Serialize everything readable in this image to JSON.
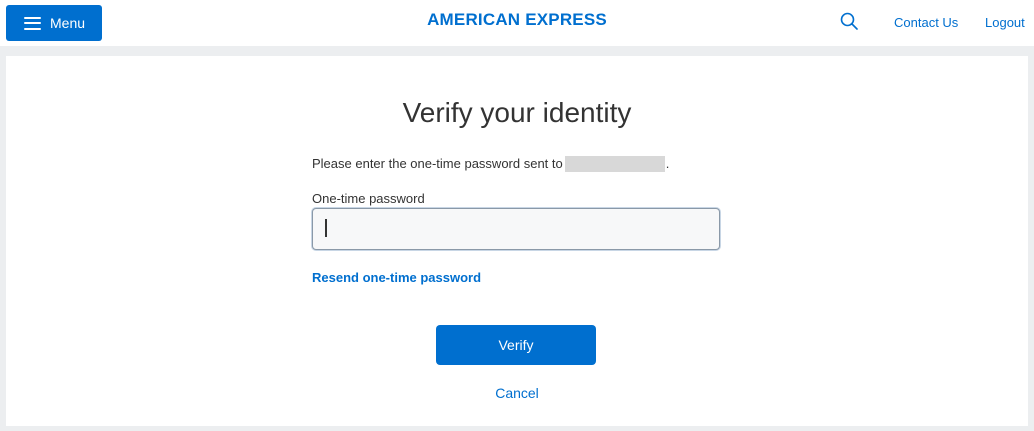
{
  "header": {
    "menu_label": "Menu",
    "brand": "AMERICAN EXPRESS",
    "contact_label": "Contact Us",
    "logout_label": "Logout"
  },
  "main": {
    "title": "Verify your identity",
    "instruction_prefix": "Please enter the one-time password sent to",
    "instruction_suffix": ".",
    "otp_field": {
      "label": "One-time password",
      "value": "",
      "placeholder": ""
    },
    "resend_label": "Resend one-time password",
    "verify_label": "Verify",
    "cancel_label": "Cancel"
  },
  "icons": {
    "menu": "hamburger-icon",
    "search": "search-icon"
  },
  "colors": {
    "brand_blue": "#006fcf",
    "page_background": "#eceef0",
    "redaction": "#d8d8d8"
  }
}
